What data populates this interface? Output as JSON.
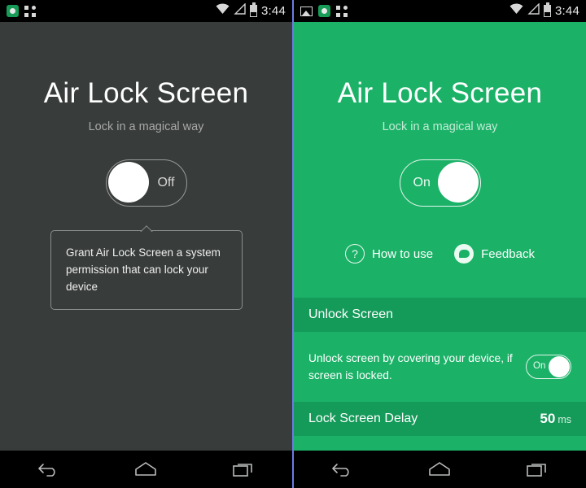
{
  "app": {
    "title": "Air Lock Screen",
    "subtitle": "Lock in a magical way"
  },
  "colors": {
    "green_body": "#1bb268",
    "green_header": "#149a59",
    "dark_body": "#383c3b",
    "status_bar": "#000000",
    "nav_bar": "#000000",
    "white": "#ffffff"
  },
  "left_panel": {
    "status_bar": {
      "time": "3:44",
      "left_icons": [
        "app-circle-icon",
        "apps-grid-icon"
      ],
      "right_icons": [
        "wifi-icon",
        "signal-icon",
        "battery-icon"
      ]
    },
    "title": "Air Lock Screen",
    "subtitle": "Lock in a magical way",
    "master_toggle": {
      "label": "Off",
      "state": "off"
    },
    "tooltip": {
      "text": "Grant Air Lock Screen a system permission that can lock your device"
    }
  },
  "right_panel": {
    "status_bar": {
      "time": "3:44",
      "left_icons": [
        "photo-icon",
        "app-circle-icon",
        "apps-grid-icon"
      ],
      "right_icons": [
        "wifi-icon",
        "signal-icon",
        "battery-icon"
      ]
    },
    "title": "Air Lock Screen",
    "subtitle": "Lock in a magical way",
    "master_toggle": {
      "label": "On",
      "state": "on"
    },
    "links": [
      {
        "label": "How to use",
        "icon": "question-mark-icon"
      },
      {
        "label": "Feedback",
        "icon": "chat-bubble-icon"
      }
    ],
    "sections": [
      {
        "header": "Unlock Screen",
        "row_text": "Unlock screen by covering your device, if screen is locked.",
        "row_toggle_label": "On",
        "row_toggle_state": "on"
      },
      {
        "header": "Lock Screen Delay",
        "value": "50",
        "unit": "ms"
      }
    ]
  },
  "nav_bar": {
    "buttons": [
      "back-button",
      "home-button",
      "recents-button"
    ]
  }
}
